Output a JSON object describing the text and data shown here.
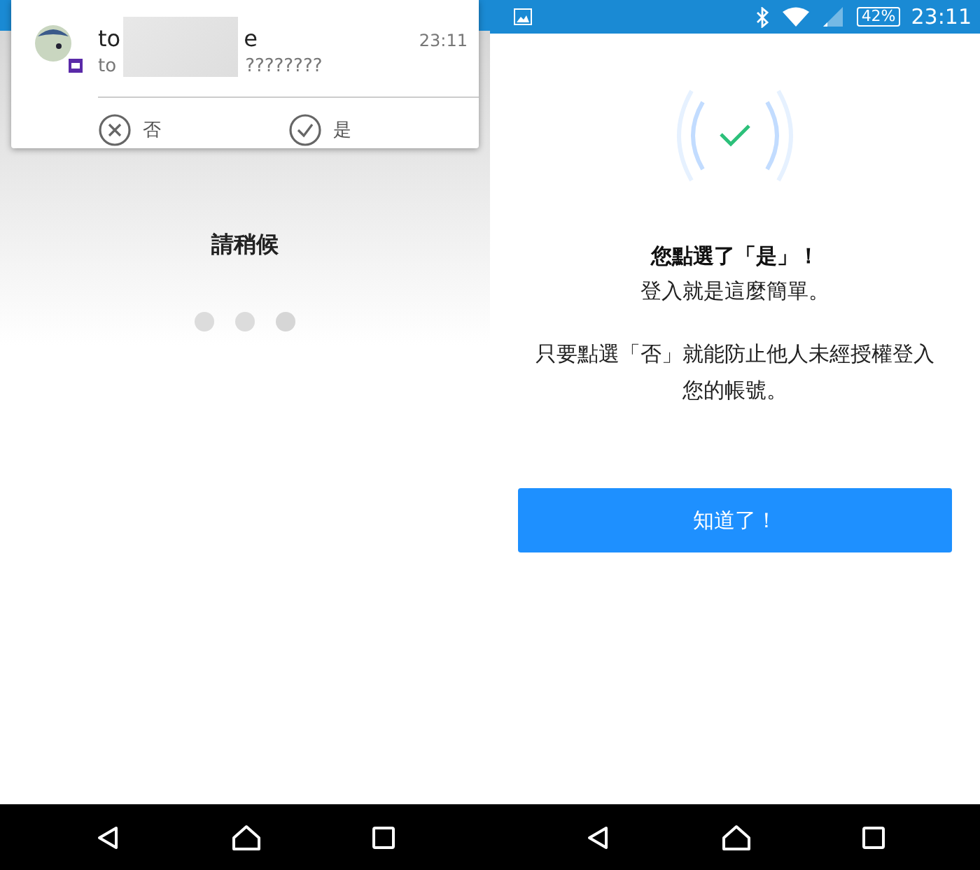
{
  "left_panel": {
    "notification": {
      "title_start": "to",
      "title_end": "e",
      "time": "23:11",
      "message_start": "to",
      "message_end": "????????",
      "actions": [
        {
          "kind": "deny",
          "label": "否"
        },
        {
          "kind": "approve",
          "label": "是"
        }
      ]
    },
    "waiting_text": "請稍候"
  },
  "right_panel": {
    "status_bar": {
      "battery": "42%",
      "time": "23:11"
    },
    "heading": "您點選了「是」！",
    "subheading": "登入就是這麼簡單。",
    "body": "只要點選「否」就能防止他人未經授權登入您的帳號。",
    "button": "知道了！"
  }
}
